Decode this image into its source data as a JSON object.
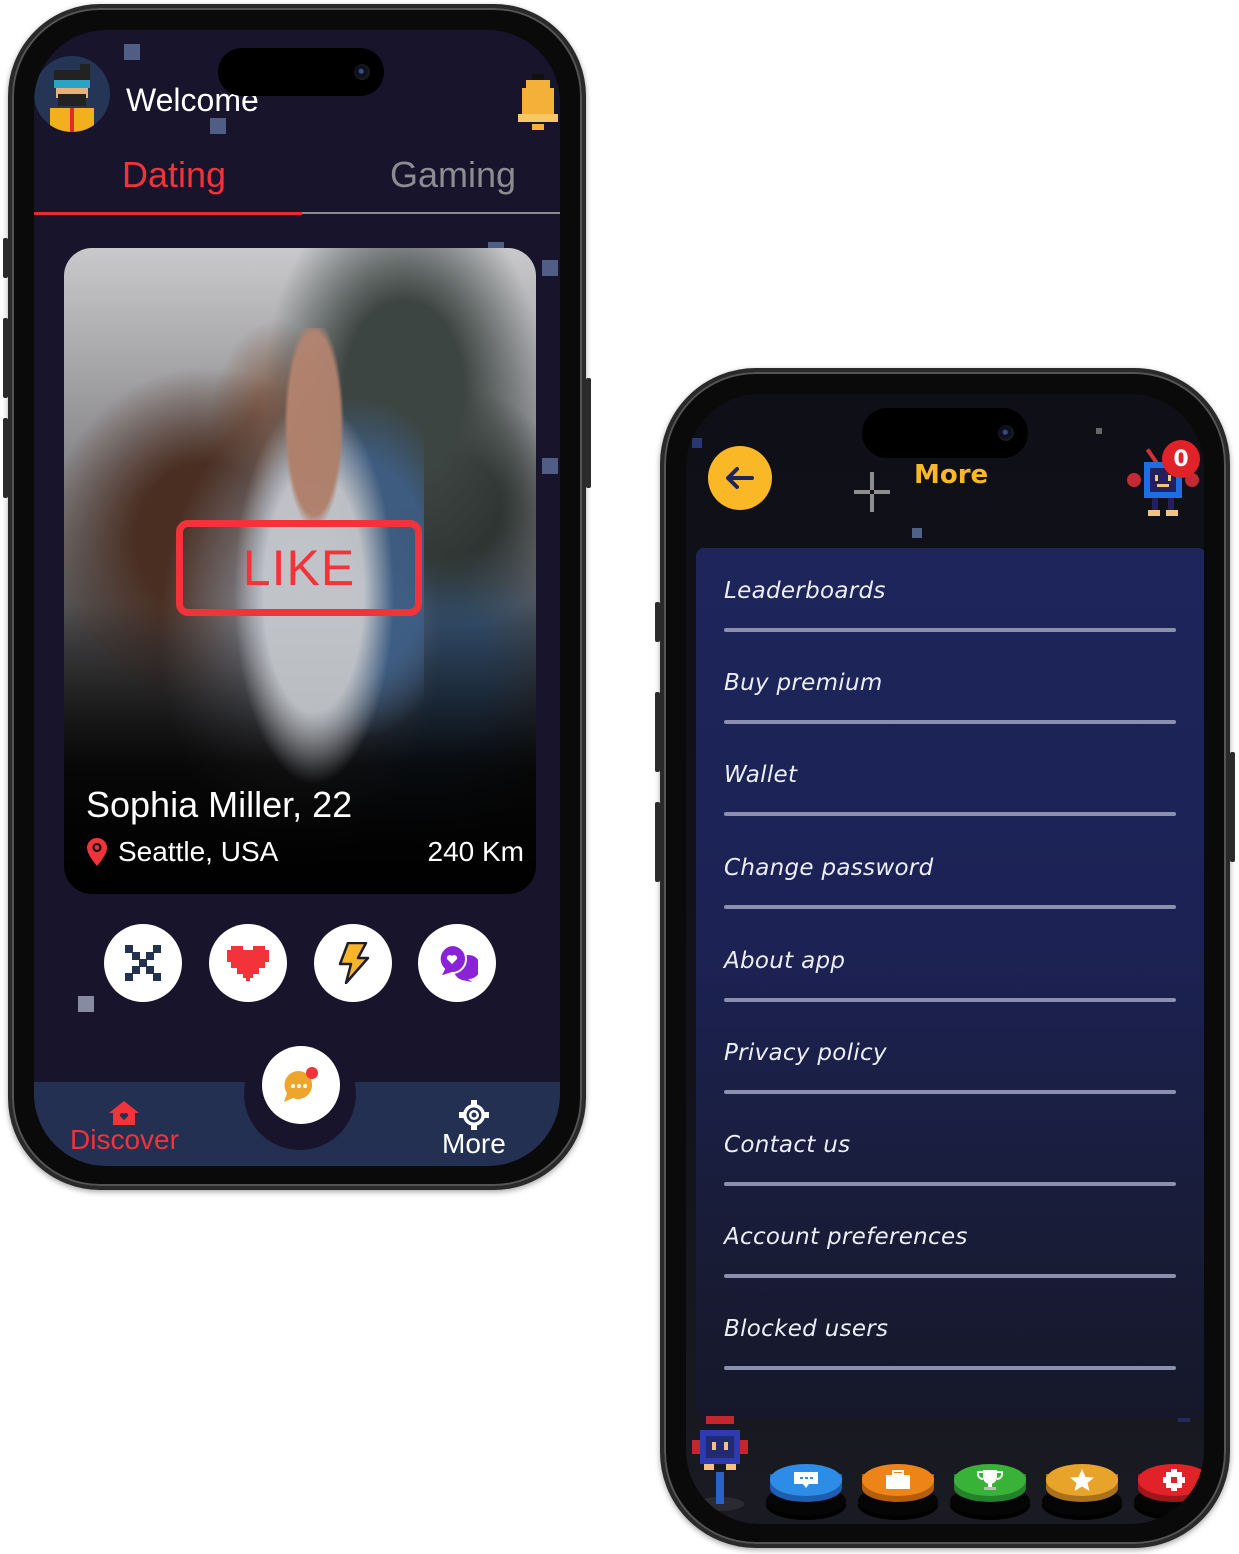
{
  "dating_screen": {
    "header": {
      "welcome_text": "Welcome",
      "avatar_icon": "pixel-avatar-icon",
      "notification_icon": "bell-icon"
    },
    "tabs": [
      {
        "label": "Dating",
        "active": true
      },
      {
        "label": "Gaming",
        "active": false
      }
    ],
    "profile_card": {
      "stamp_label": "LIKE",
      "name_age": "Sophia Miller, 22",
      "location": "Seattle, USA",
      "distance": "240 Km",
      "location_icon": "map-pin-icon"
    },
    "actions": [
      {
        "name": "dislike",
        "icon": "pixel-x-icon"
      },
      {
        "name": "like",
        "icon": "pixel-heart-icon"
      },
      {
        "name": "boost",
        "icon": "lightning-icon"
      },
      {
        "name": "super-chat",
        "icon": "chat-heart-icon"
      }
    ],
    "bottom_nav": {
      "items": [
        {
          "label": "Discover",
          "icon": "home-heart-icon",
          "active": true
        },
        {
          "label": "More",
          "icon": "gear-icon",
          "active": false
        }
      ],
      "center_button_icon": "chat-bubble-icon",
      "center_has_notification": true
    },
    "colors": {
      "accent": "#f2333a",
      "background": "#17142b",
      "nav_background": "#233052",
      "inactive_tab": "#8c8c93"
    }
  },
  "more_screen": {
    "header": {
      "title": "More",
      "back_icon": "arrow-left-icon",
      "mascot_icon": "pixel-robot-icon",
      "notification_count": "0"
    },
    "menu_items": [
      {
        "label": "Leaderboards"
      },
      {
        "label": "Buy premium"
      },
      {
        "label": "Wallet"
      },
      {
        "label": "Change password"
      },
      {
        "label": "About app"
      },
      {
        "label": "Privacy policy"
      },
      {
        "label": "Contact us"
      },
      {
        "label": "Account preferences"
      },
      {
        "label": "Blocked users"
      }
    ],
    "bottom_bar": {
      "joystick_icon": "pixel-robot-joystick-icon",
      "buttons": [
        {
          "name": "chat",
          "icon": "chat-icon",
          "color": "#2d8ce6"
        },
        {
          "name": "shop",
          "icon": "briefcase-icon",
          "color": "#ec8417"
        },
        {
          "name": "trophy",
          "icon": "trophy-icon",
          "color": "#38b338"
        },
        {
          "name": "favorites",
          "icon": "star-icon",
          "color": "#e8a32a"
        },
        {
          "name": "settings",
          "icon": "gear-icon",
          "color": "#e12228"
        }
      ]
    },
    "colors": {
      "accent": "#fbb826",
      "menu_background": "#1d255a",
      "badge": "#e12228"
    }
  }
}
